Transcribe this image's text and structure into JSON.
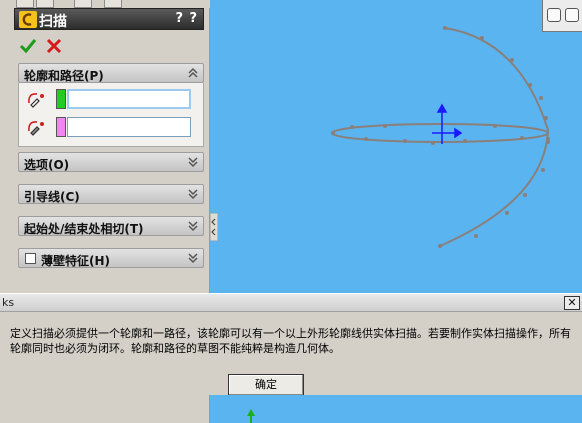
{
  "panel": {
    "title": "扫描",
    "help_label": "?",
    "help2_label": "?",
    "groups": {
      "profile_path": {
        "label": "轮廓和路径(P)"
      },
      "options": {
        "label": "选项(O)"
      },
      "guide_curves": {
        "label": "引导线(C)"
      },
      "start_end_tangency": {
        "label": "起始处/结束处相切(T)"
      },
      "thin_feature": {
        "label": "薄壁特征(H)",
        "checked": false
      }
    },
    "profile": {
      "value": "",
      "swatch_color": "#22cc22"
    },
    "path": {
      "value": "",
      "swatch_color": "#ee88ee"
    }
  },
  "viewport": {
    "curve_color": "#8a7f7a",
    "origin_color": "#1a1aff"
  },
  "dialog": {
    "title": "ks",
    "close_label": "✕",
    "message": "定义扫描必须提供一个轮廓和一路径，该轮廓可以有一个以上外形轮廓线供实体扫描。若要制作实体扫描操作，所有轮廓同时也必须为闭环。轮廓和路径的草图不能纯粹是构造几何体。",
    "ok_label": "确定"
  }
}
